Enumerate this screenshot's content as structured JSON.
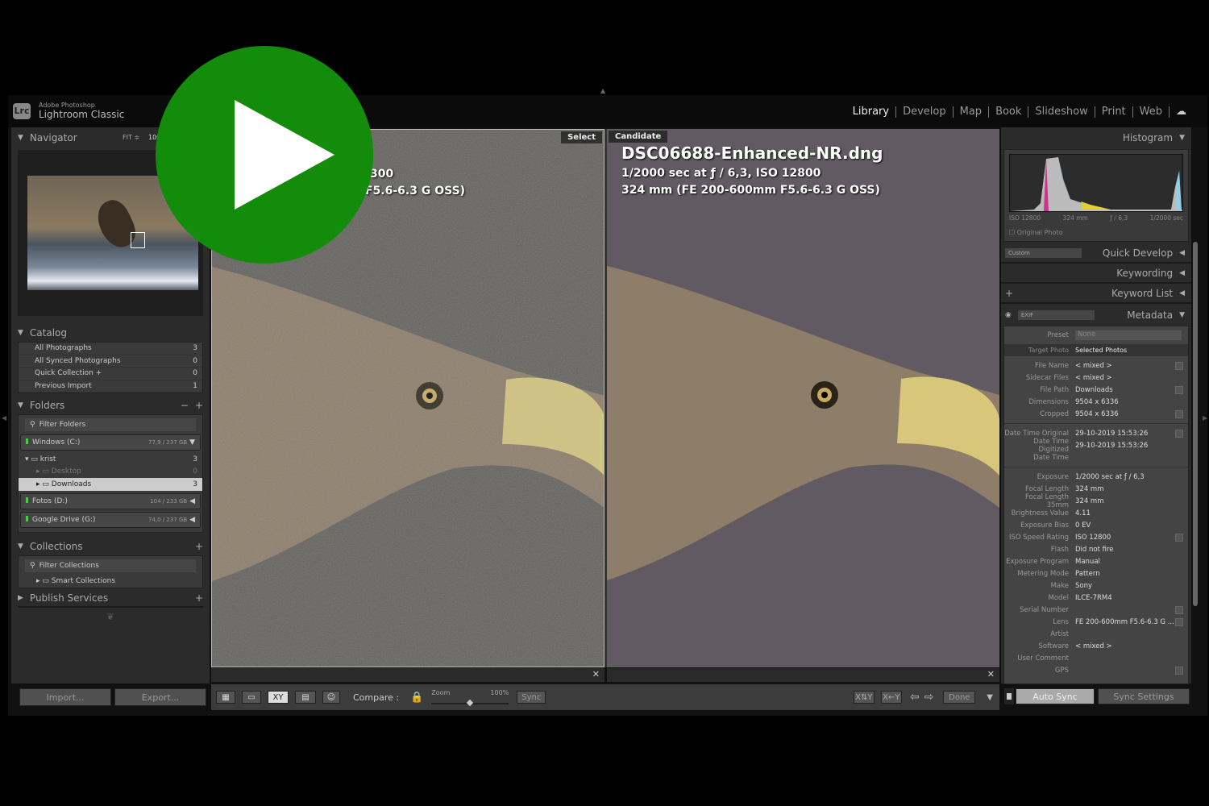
{
  "brand": {
    "line1": "Adobe Photoshop",
    "line2": "Lightroom Classic",
    "badge": "Lrc"
  },
  "modules": [
    "Library",
    "Develop",
    "Map",
    "Book",
    "Slideshow",
    "Print",
    "Web"
  ],
  "navigator": {
    "title": "Navigator",
    "fit": "FIT ≑",
    "zoom": "100"
  },
  "catalog": {
    "title": "Catalog",
    "items": [
      {
        "label": "All Photographs",
        "count": "3"
      },
      {
        "label": "All Synced Photographs",
        "count": "0"
      },
      {
        "label": "Quick Collection +",
        "count": "0"
      },
      {
        "label": "Previous Import",
        "count": "1"
      }
    ]
  },
  "folders": {
    "title": "Folders",
    "filter": "Filter Folders",
    "volumes": [
      {
        "name": "Windows (C:)",
        "size": "77,9 / 237 GB"
      },
      {
        "name": "Fotos (D:)",
        "size": "104 / 233 GB"
      },
      {
        "name": "Google Drive (G:)",
        "size": "74,0 / 237 GB"
      }
    ],
    "tree": [
      {
        "label": "krist",
        "count": "3"
      },
      {
        "label": "Desktop",
        "count": "0"
      },
      {
        "label": "Downloads",
        "count": "3"
      }
    ]
  },
  "collections": {
    "title": "Collections",
    "filter": "Filter Collections",
    "items": [
      "Smart Collections"
    ]
  },
  "publish": {
    "title": "Publish Services"
  },
  "buttons": {
    "import": "Import...",
    "export": "Export..."
  },
  "select_view": {
    "tag": "Select",
    "line1": "300",
    "line2": "F5.6-6.3 G OSS)"
  },
  "candidate_view": {
    "tag": "Candidate",
    "filename": "DSC06688-Enhanced-NR.dng",
    "line1": "1/2000 sec at ƒ / 6,3, ISO 12800",
    "line2": "324 mm (FE 200-600mm F5.6-6.3 G OSS)"
  },
  "toolbar": {
    "compare": "Compare :",
    "zoom": "Zoom",
    "zoom_value": "100%",
    "sync": "Sync",
    "done": "Done"
  },
  "histogram": {
    "title": "Histogram",
    "iso": "ISO 12800",
    "focal": "324 mm",
    "aperture": "ƒ / 6,3",
    "shutter": "1/2000 sec",
    "original": "Original Photo"
  },
  "quick_develop": {
    "title": "Quick Develop",
    "preset": "Custom"
  },
  "keywording": {
    "title": "Keywording"
  },
  "keyword_list": {
    "title": "Keyword List"
  },
  "metadata": {
    "title": "Metadata",
    "set": "EXIF",
    "preset_label": "Preset",
    "preset": "None",
    "target": "Target Photo",
    "selected": "Selected Photos",
    "groups": [
      [
        {
          "k": "File Name",
          "v": "< mixed >"
        },
        {
          "k": "Sidecar Files",
          "v": "< mixed >"
        },
        {
          "k": "File Path",
          "v": "Downloads"
        },
        {
          "k": "Dimensions",
          "v": "9504 x 6336"
        },
        {
          "k": "Cropped",
          "v": "9504 x 6336"
        }
      ],
      [
        {
          "k": "Date Time Original",
          "v": "29-10-2019 15:53:26"
        },
        {
          "k": "Date Time Digitized",
          "v": "29-10-2019 15:53:26"
        },
        {
          "k": "Date Time",
          "v": ""
        }
      ],
      [
        {
          "k": "Exposure",
          "v": "1/2000 sec at ƒ / 6,3"
        },
        {
          "k": "Focal Length",
          "v": "324 mm"
        },
        {
          "k": "Focal Length 35mm",
          "v": "324 mm"
        },
        {
          "k": "Brightness Value",
          "v": "4.11"
        },
        {
          "k": "Exposure Bias",
          "v": "0 EV"
        },
        {
          "k": "ISO Speed Rating",
          "v": "ISO 12800"
        },
        {
          "k": "Flash",
          "v": "Did not fire"
        },
        {
          "k": "Exposure Program",
          "v": "Manual"
        },
        {
          "k": "Metering Mode",
          "v": "Pattern"
        },
        {
          "k": "Make",
          "v": "Sony"
        },
        {
          "k": "Model",
          "v": "ILCE-7RM4"
        },
        {
          "k": "Serial Number",
          "v": ""
        },
        {
          "k": "Lens",
          "v": "FE 200-600mm F5.6-6.3 G ..."
        },
        {
          "k": "Artist",
          "v": ""
        },
        {
          "k": "Software",
          "v": "< mixed >"
        },
        {
          "k": "User Comment",
          "v": ""
        },
        {
          "k": "GPS",
          "v": ""
        }
      ]
    ]
  },
  "sync": {
    "auto": "Auto Sync",
    "settings": "Sync Settings"
  },
  "colors": {
    "play": "#128c0a",
    "panel": "#2b2b2b"
  }
}
